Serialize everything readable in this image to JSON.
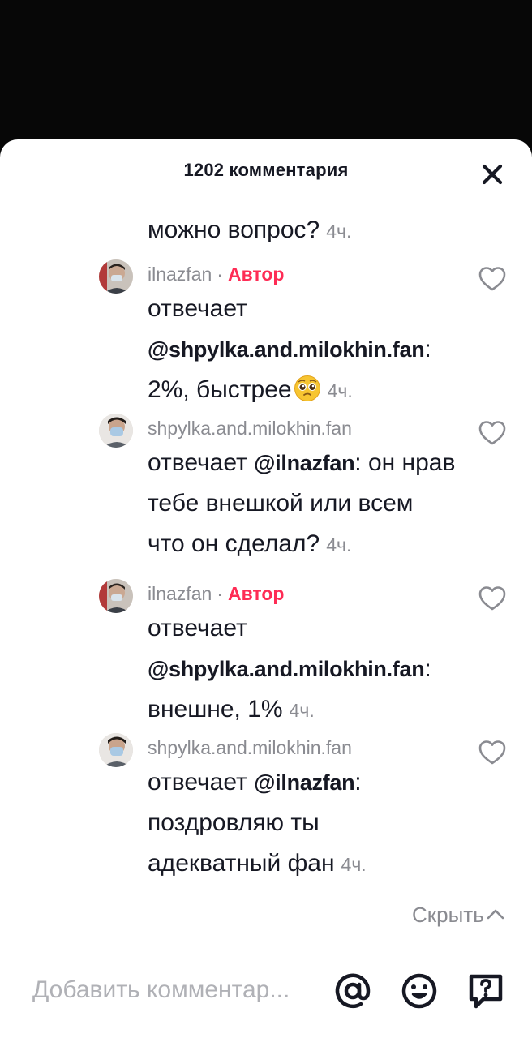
{
  "header": {
    "title": "1202 комментария"
  },
  "partial_comment": {
    "text": "можно вопрос?",
    "time": "4ч."
  },
  "comments": [
    {
      "username": "ilnazfan",
      "separator": "·",
      "badge": "Автор",
      "reply_prefix": "отвечает ",
      "mention": "@shpylka.and.milokhin.fan",
      "text_after": ": 2%, быстрее",
      "emoji": "pleading-face-emoji",
      "time": "4ч."
    },
    {
      "username": "shpylka.and.milokhin.fan",
      "reply_prefix": "отвечает ",
      "mention": "@ilnazfan",
      "text_after": ": он нрав тебе внешкой или всем что он сделал?",
      "time": "4ч."
    },
    {
      "username": "ilnazfan",
      "separator": "·",
      "badge": "Автор",
      "reply_prefix": "отвечает ",
      "mention": "@shpylka.and.milokhin.fan",
      "text_after": ": внешне, 1%",
      "time": "4ч."
    },
    {
      "username": "shpylka.and.milokhin.fan",
      "reply_prefix": "отвечает ",
      "mention": "@ilnazfan",
      "text_after": ": поздровляю ты адекватный фан",
      "time": "4ч."
    }
  ],
  "hide_replies": {
    "label": "Скрыть"
  },
  "composer": {
    "placeholder": "Добавить комментар..."
  },
  "icons": {
    "close": "close-icon",
    "like": "heart-outline-icon",
    "mention": "at-sign-icon",
    "emoji": "emoji-face-icon",
    "question": "question-bubble-icon",
    "hide_chevron": "chevron-up-icon"
  },
  "colors": {
    "author_badge": "#fe2c55",
    "secondary_text": "#8a8b91",
    "primary_text": "#161823",
    "background_dark": "#0b0b0b"
  }
}
